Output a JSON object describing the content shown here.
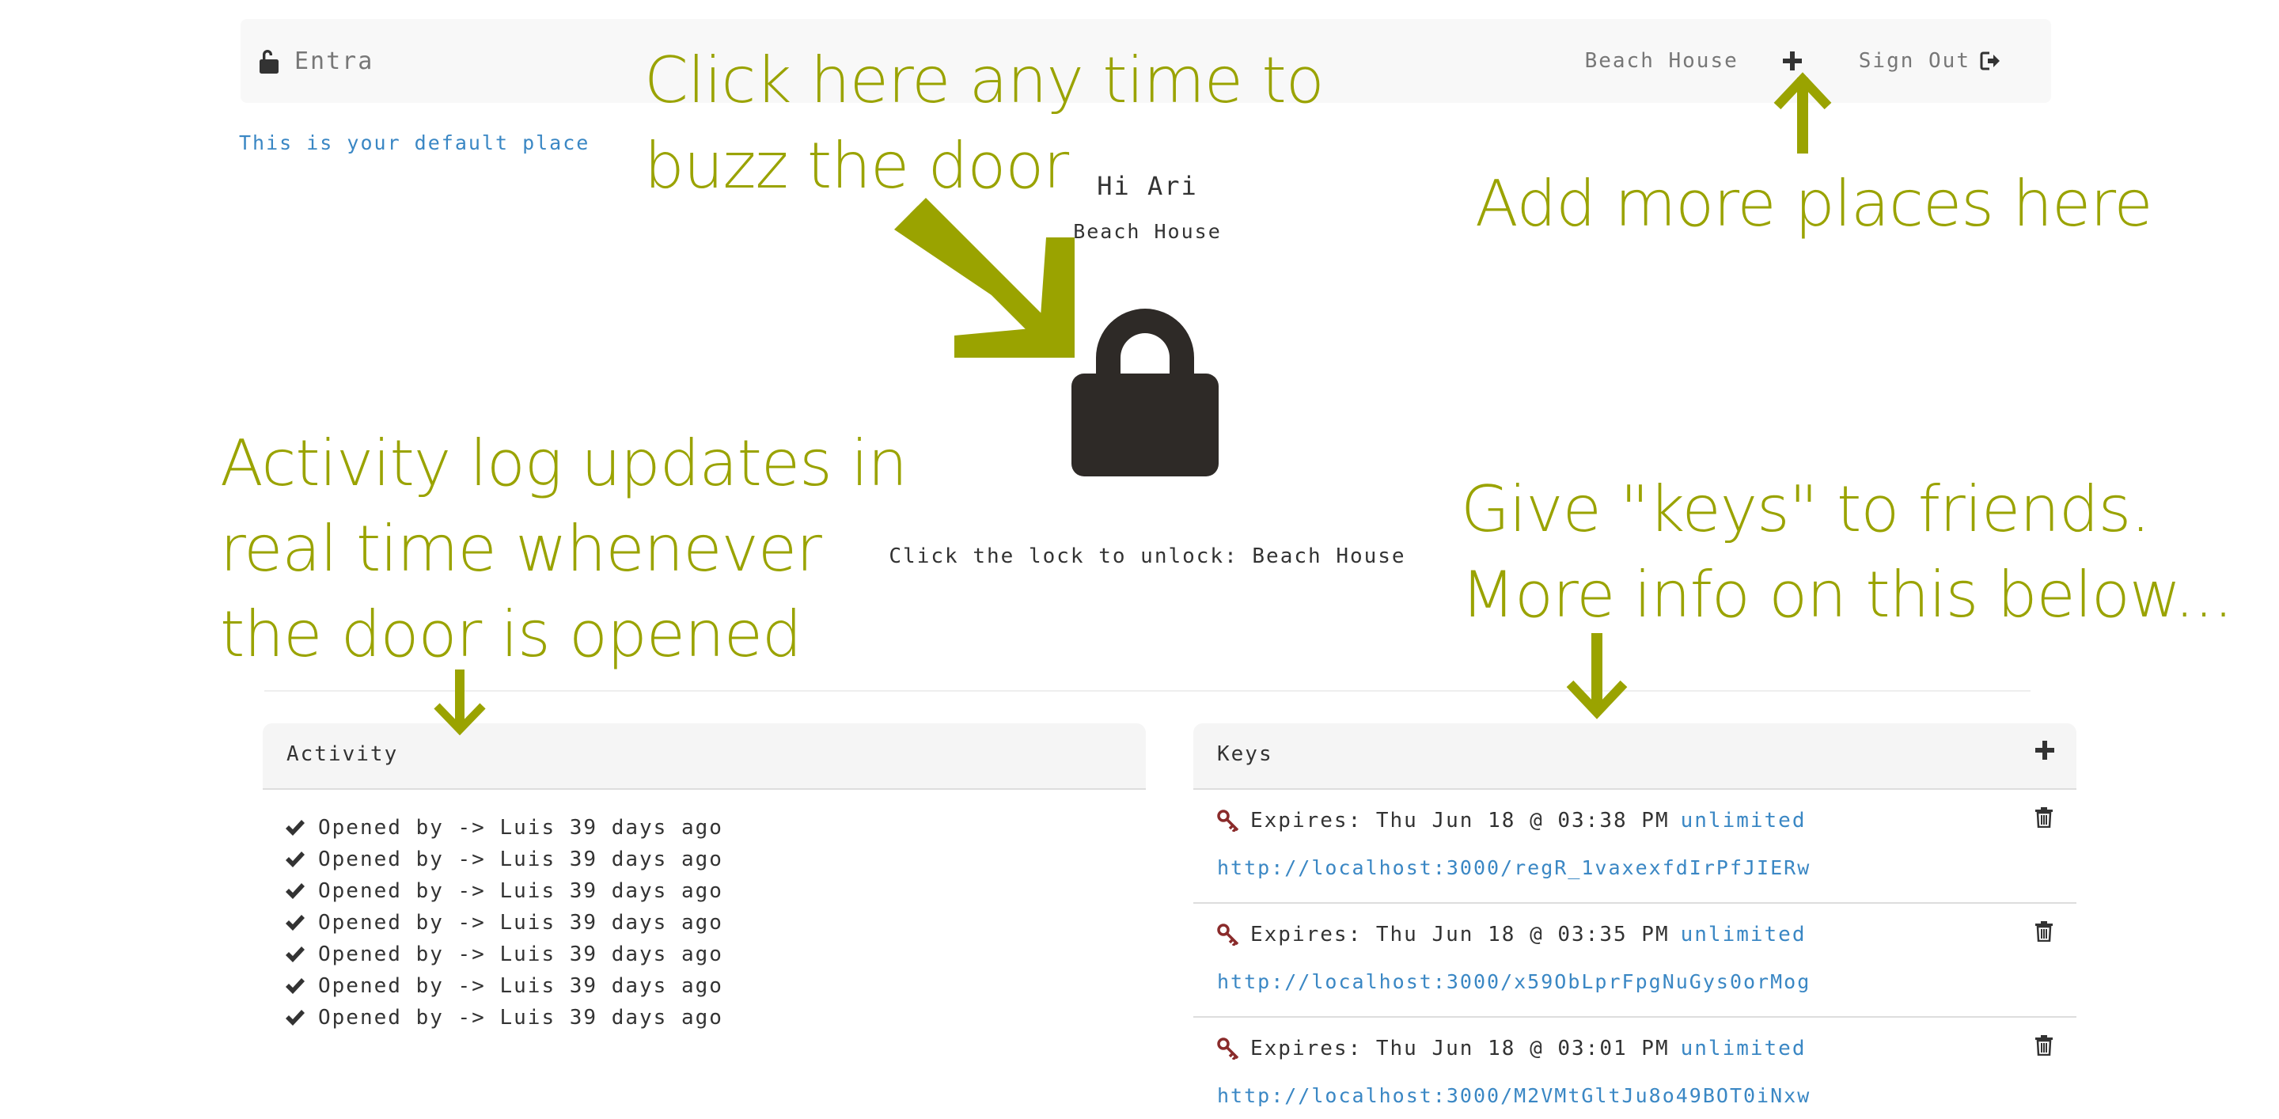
{
  "navbar": {
    "brand": "Entra",
    "place_link": "Beach House",
    "sign_out": "Sign Out"
  },
  "default_place_link": "This is your default place",
  "main": {
    "greeting": "Hi Ari",
    "place_name": "Beach House",
    "unlock_hint": "Click the lock to unlock: Beach House"
  },
  "annotations": {
    "buzz": "Click here any time to\nbuzz the door",
    "places": "Add more places here",
    "activity": "Activity log updates in\nreal time whenever\nthe door is opened",
    "keys": "Give \"keys\" to friends.\nMore info on this below..."
  },
  "activity": {
    "title": "Activity",
    "items": [
      "Opened by -> Luis 39 days ago",
      "Opened by -> Luis 39 days ago",
      "Opened by -> Luis 39 days ago",
      "Opened by -> Luis 39 days ago",
      "Opened by -> Luis 39 days ago",
      "Opened by -> Luis 39 days ago",
      "Opened by -> Luis 39 days ago"
    ]
  },
  "keys": {
    "title": "Keys",
    "items": [
      {
        "expires": "Expires: Thu Jun 18 @ 03:38 PM",
        "limit": "unlimited",
        "url": "http://localhost:3000/regR_1vaxexfdIrPfJIERw"
      },
      {
        "expires": "Expires: Thu Jun 18 @ 03:35 PM",
        "limit": "unlimited",
        "url": "http://localhost:3000/x59ObLprFpgNuGys0orMog"
      },
      {
        "expires": "Expires: Thu Jun 18 @ 03:01 PM",
        "limit": "unlimited",
        "url": "http://localhost:3000/M2VMtGltJu8o49BOT0iNxw"
      }
    ]
  },
  "colors": {
    "annotation": "#9aa300",
    "link": "#3a87c4",
    "text": "#333333",
    "muted": "#777777",
    "key_icon": "#8a2b2b",
    "lock": "#2e2a27"
  },
  "icons": {
    "brand": "unlocked-padlock-icon",
    "add": "plus-icon",
    "sign_out": "sign-out-icon",
    "main": "padlock-icon",
    "activity_item": "checkmark-icon",
    "key_item": "key-icon",
    "delete": "trash-icon"
  }
}
